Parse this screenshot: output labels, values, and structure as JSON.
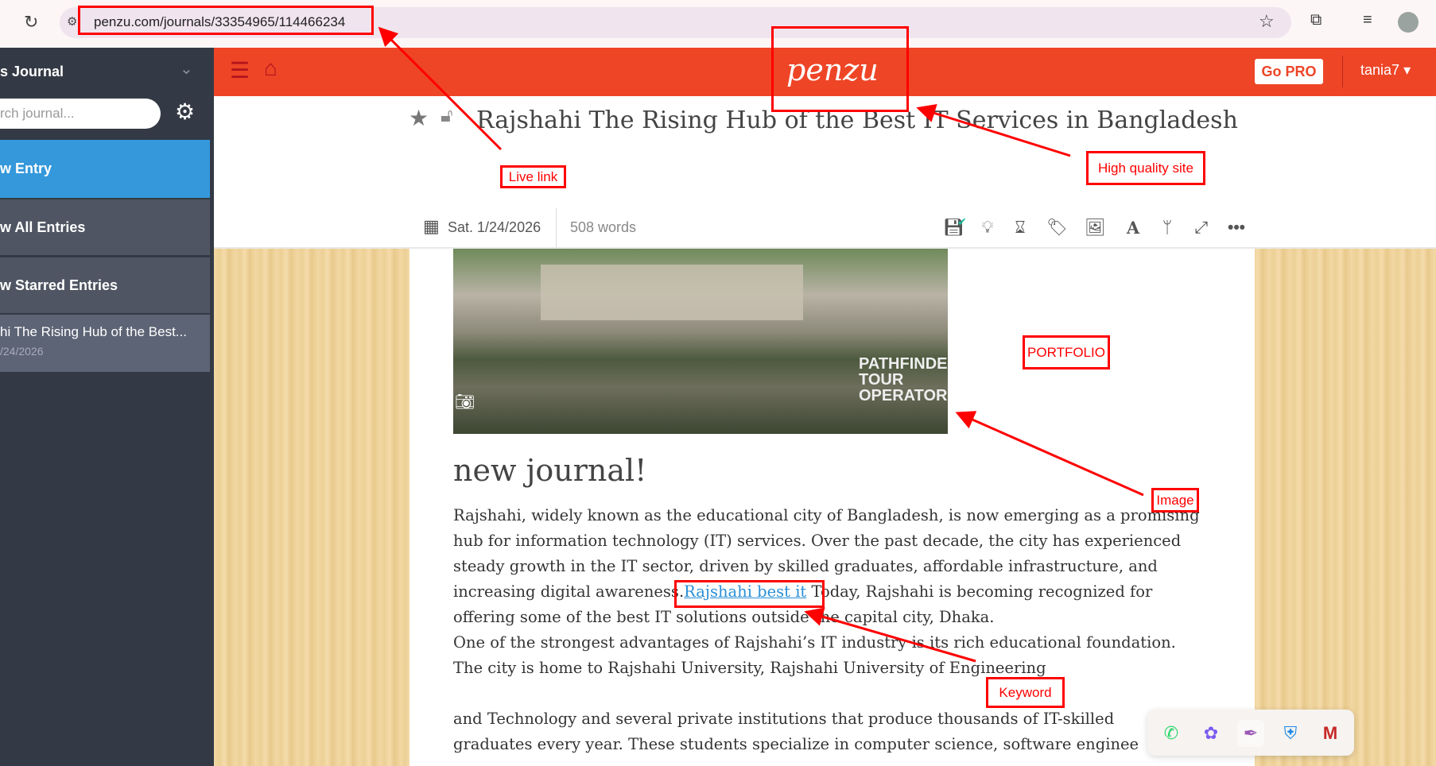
{
  "browser": {
    "url": "penzu.com/journals/33354965/114466234"
  },
  "sidebar": {
    "journal_title": "s Journal",
    "search_placeholder": "rch journal...",
    "items": [
      {
        "label": "w Entry"
      },
      {
        "label": "w All Entries"
      },
      {
        "label": "w Starred Entries"
      }
    ],
    "entry": {
      "title": "hi The Rising Hub of the Best...",
      "date": "/24/2026"
    }
  },
  "header": {
    "logo": "penzu",
    "go_pro": "Go PRO",
    "user": "tania7"
  },
  "entry": {
    "title": "Rajshahi The Rising Hub of the Best IT Services in Bangladesh",
    "date": "Sat. 1/24/2026",
    "words": "508 words",
    "heading": "new journal!",
    "image_watermark": "PATHFINDER TOUR OPERATOR",
    "lines": [
      "Rajshahi, widely known as the educational city of Bangladesh, is now emerging as a promising",
      "hub for information technology (IT) services. Over the past decade, the city has experienced",
      "steady growth in the IT sector, driven by skilled graduates, affordable infrastructure, and",
      "",
      "offering some of the best IT solutions outside the capital city, Dhaka.",
      "One of the strongest advantages of Rajshahi’s IT industry is its rich educational foundation.",
      "The city is home to Rajshahi University, Rajshahi University of Engineering",
      "and Technology  and several private institutions that produce thousands of IT-skilled",
      "graduates every year. These students specialize in computer science, software enginee"
    ],
    "line4_before": "increasing digital awareness.",
    "link_text": "Rajshahi best it",
    "line4_after": "  Today, Rajshahi is becoming recognized for"
  },
  "annotations": {
    "live_link": "Live link",
    "high_quality": "High quality site",
    "portfolio": "PORTFOLIO",
    "image": "Image",
    "keyword": "Keyword"
  },
  "colors": {
    "brand": "#ee4527",
    "sidebar": "#343a45",
    "active": "#3498db",
    "annotation": "#ff0000",
    "link": "#2a8fd6"
  }
}
